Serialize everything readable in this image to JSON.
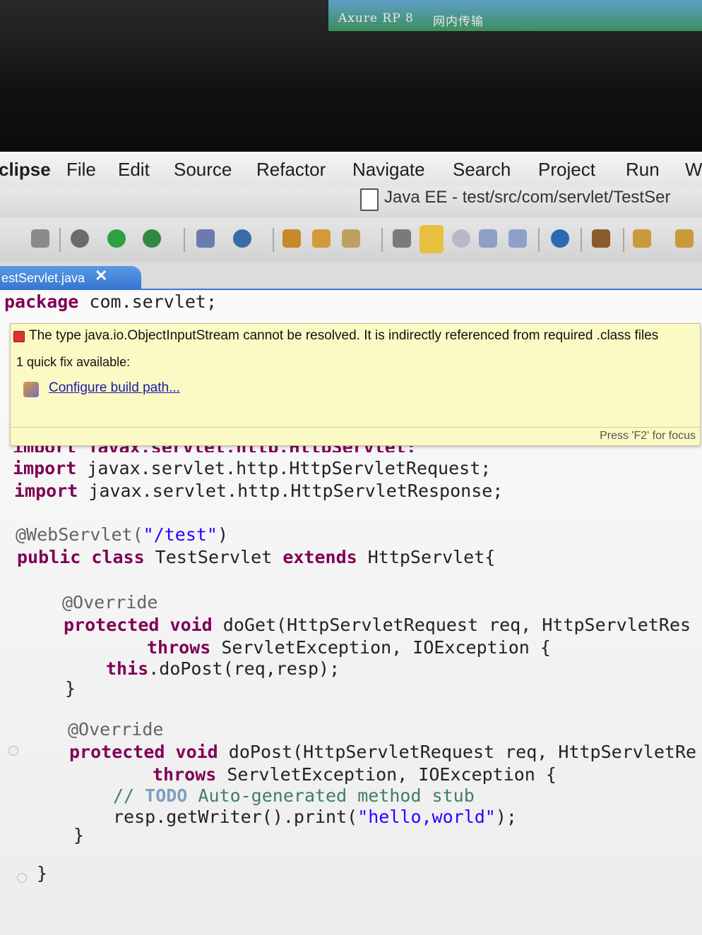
{
  "desktop": {
    "items": [
      "Axure RP 8",
      "网内传输"
    ]
  },
  "menubar": {
    "items": [
      "clipse",
      "File",
      "Edit",
      "Source",
      "Refactor",
      "Navigate",
      "Search",
      "Project",
      "Run",
      "W"
    ]
  },
  "titlebar": {
    "title": "Java EE - test/src/com/servlet/TestSer"
  },
  "toolbar": {
    "icons": [
      "print-icon",
      "debug-icon",
      "run-icon",
      "run-external-icon",
      "new-server-icon",
      "new-class-icon",
      "open-type-icon",
      "open-task-icon",
      "search-icon",
      "annotation-icon",
      "mark-occurrences-icon",
      "show-whitespace-icon",
      "block-select-icon",
      "paragraph-icon",
      "globe-icon",
      "search-refs-icon",
      "next-annotation-icon",
      "prev-annotation-icon"
    ]
  },
  "tab": {
    "label": "estServlet.java",
    "close": "✕"
  },
  "popup": {
    "message": "The type java.io.ObjectInputStream cannot be resolved. It is indirectly referenced from required .class files",
    "quickfix_count": "1 quick fix available:",
    "fix_label": "Configure build path...",
    "hint": "Press 'F2' for focus"
  },
  "code": {
    "package_kw": "package",
    "package_name": " com.servlet;",
    "partial_import": "import javax.servlet.http.HttpServlet;",
    "import1_kw": "import",
    "import1": " javax.servlet.http.HttpServletRequest;",
    "import2_kw": "import",
    "import2": " javax.servlet.http.HttpServletResponse;",
    "ann_webservlet": "@WebServlet(",
    "webservlet_str": "\"/test\"",
    "webservlet_close": ")",
    "class_public": "public",
    "class_class": "class",
    "class_name": " TestServlet ",
    "class_extends": "extends",
    "class_super": " HttpServlet{",
    "override1": "@Override",
    "doget_protected": "protected",
    "doget_void": "void",
    "doget_sig": " doGet(HttpServletRequest req, HttpServletRes",
    "throws1": "throws",
    "throws1_rest": " ServletException, IOException {",
    "this_kw": "this",
    "this_rest": ".doPost(req,resp);",
    "close1": "}",
    "override2": "@Override",
    "dopost_protected": "protected",
    "dopost_void": "void",
    "dopost_sig": " doPost(HttpServletRequest req, HttpServletRe",
    "throws2": "throws",
    "throws2_rest": " ServletException, IOException {",
    "comment_slashes": "// ",
    "comment_todo": "TODO",
    "comment_rest": " Auto-generated method stub",
    "print_pre": "resp.getWriter().print(",
    "print_str": "\"hello,world\"",
    "print_post": ");",
    "close2": "}",
    "close3": "}"
  }
}
